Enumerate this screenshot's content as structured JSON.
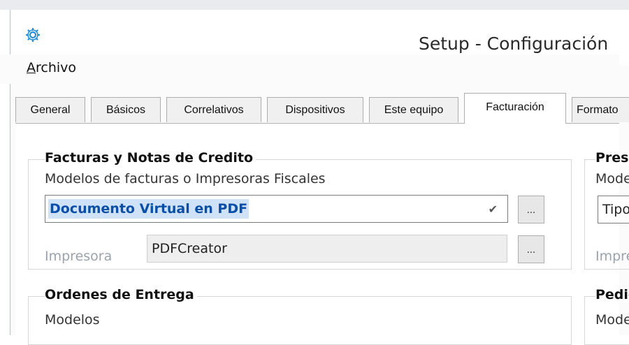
{
  "window": {
    "title": "Setup - Configuración",
    "icon": "gear-icon"
  },
  "menu": {
    "archivo": {
      "underline_char": "A",
      "rest": "rchivo"
    }
  },
  "tabs": [
    {
      "label": "General"
    },
    {
      "label": "Básicos"
    },
    {
      "label": "Correlativos"
    },
    {
      "label": "Dispositivos"
    },
    {
      "label": "Este equipo"
    },
    {
      "label": "Facturación",
      "active": true
    },
    {
      "label": "Formato"
    }
  ],
  "facturas_group": {
    "title": "Facturas y Notas de Credito",
    "subtitle": "Modelos de facturas o Impresoras Fiscales",
    "model_select": {
      "value": "Documento Virtual en PDF"
    },
    "model_button": "...",
    "printer_label": "Impresora",
    "printer_value": "PDFCreator",
    "printer_button": "..."
  },
  "ordenes_group": {
    "title": "Ordenes de Entrega",
    "subtitle": "Modelos"
  },
  "right_column": {
    "group1_title": "Presupuestos",
    "group1_subtitle": "Modelos",
    "group1_input": "Tipo",
    "group1_printer_label": "Impresora",
    "group2_title": "Pedidos",
    "group2_subtitle": "Modelos"
  }
}
